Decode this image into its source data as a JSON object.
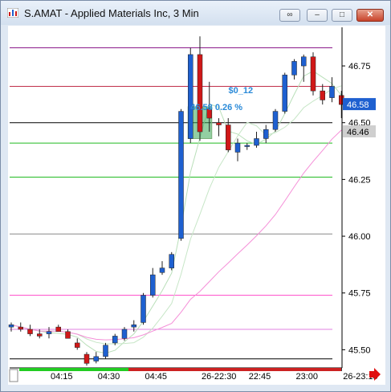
{
  "window": {
    "title": "S.AMAT - Applied Materials Inc, 3 Min",
    "buttons": [
      "link-icon",
      "minimize-icon",
      "restore-icon",
      "close-icon"
    ]
  },
  "chart_data": {
    "type": "candlestick",
    "symbol": "S.AMAT",
    "interval": "3 Min",
    "y_ticks": [
      "46.75",
      "46.50",
      "46.25",
      "46.00",
      "45.75",
      "45.50"
    ],
    "ylim": [
      45.42,
      46.92
    ],
    "x_ticks": [
      "04:15",
      "04:30",
      "04:45",
      "26-22:30",
      "22:45",
      "23:00",
      "26-23:15"
    ],
    "last_price_label": "46.58",
    "crosshair_price_label": "46.46",
    "measure": {
      "change": "$0_12",
      "detail": "46.58 0.26 %"
    },
    "levels": [
      {
        "price": 46.83,
        "color": "#8b1a8b"
      },
      {
        "price": 46.66,
        "color": "#c0304a"
      },
      {
        "price": 46.5,
        "color": "#000000"
      },
      {
        "price": 46.41,
        "color": "#22bb22"
      },
      {
        "price": 46.26,
        "color": "#22bb22"
      },
      {
        "price": 46.01,
        "color": "#888888"
      },
      {
        "price": 45.74,
        "color": "#ff55cc"
      },
      {
        "price": 45.59,
        "color": "#e080e0"
      },
      {
        "price": 45.46,
        "color": "#000000"
      }
    ],
    "candles": [
      {
        "t": "04:03",
        "o": 45.6,
        "h": 45.62,
        "l": 45.58,
        "c": 45.61
      },
      {
        "t": "04:06",
        "o": 45.6,
        "h": 45.62,
        "l": 45.58,
        "c": 45.59
      },
      {
        "t": "04:09",
        "o": 45.59,
        "h": 45.61,
        "l": 45.56,
        "c": 45.57
      },
      {
        "t": "04:12",
        "o": 45.57,
        "h": 45.59,
        "l": 45.55,
        "c": 45.56
      },
      {
        "t": "04:15",
        "o": 45.57,
        "h": 45.6,
        "l": 45.55,
        "c": 45.58
      },
      {
        "t": "04:18",
        "o": 45.6,
        "h": 45.61,
        "l": 45.58,
        "c": 45.58
      },
      {
        "t": "04:21",
        "o": 45.58,
        "h": 45.59,
        "l": 45.55,
        "c": 45.55
      },
      {
        "t": "04:24",
        "o": 45.53,
        "h": 45.55,
        "l": 45.5,
        "c": 45.51
      },
      {
        "t": "04:27",
        "o": 45.48,
        "h": 45.49,
        "l": 45.43,
        "c": 45.44
      },
      {
        "t": "04:30",
        "o": 45.45,
        "h": 45.49,
        "l": 45.44,
        "c": 45.47
      },
      {
        "t": "04:33",
        "o": 45.47,
        "h": 45.53,
        "l": 45.46,
        "c": 45.52
      },
      {
        "t": "04:36",
        "o": 45.53,
        "h": 45.57,
        "l": 45.52,
        "c": 45.56
      },
      {
        "t": "04:39",
        "o": 45.55,
        "h": 45.6,
        "l": 45.54,
        "c": 45.59
      },
      {
        "t": "04:42",
        "o": 45.6,
        "h": 45.63,
        "l": 45.58,
        "c": 45.61
      },
      {
        "t": "04:45",
        "o": 45.62,
        "h": 45.75,
        "l": 45.61,
        "c": 45.74
      },
      {
        "t": "04:48",
        "o": 45.74,
        "h": 45.86,
        "l": 45.73,
        "c": 45.83
      },
      {
        "t": "04:51",
        "o": 45.84,
        "h": 45.89,
        "l": 45.83,
        "c": 45.86
      },
      {
        "t": "04:54",
        "o": 45.86,
        "h": 45.93,
        "l": 45.85,
        "c": 45.92
      },
      {
        "t": "04:57",
        "o": 45.99,
        "h": 46.56,
        "l": 45.98,
        "c": 46.55
      },
      {
        "t": "22:27",
        "o": 46.43,
        "h": 46.83,
        "l": 46.41,
        "c": 46.8
      },
      {
        "t": "22:30",
        "o": 46.8,
        "h": 46.88,
        "l": 46.42,
        "c": 46.46
      },
      {
        "t": "22:33",
        "o": 46.56,
        "h": 46.68,
        "l": 46.46,
        "c": 46.52
      },
      {
        "t": "22:36",
        "o": 46.5,
        "h": 46.52,
        "l": 46.44,
        "c": 46.49
      },
      {
        "t": "22:39",
        "o": 46.49,
        "h": 46.52,
        "l": 46.37,
        "c": 46.38
      },
      {
        "t": "22:42",
        "o": 46.37,
        "h": 46.43,
        "l": 46.33,
        "c": 46.41
      },
      {
        "t": "22:45",
        "o": 46.4,
        "h": 46.41,
        "l": 46.38,
        "c": 46.4
      },
      {
        "t": "22:48",
        "o": 46.4,
        "h": 46.46,
        "l": 46.39,
        "c": 46.43
      },
      {
        "t": "22:51",
        "o": 46.43,
        "h": 46.49,
        "l": 46.41,
        "c": 46.47
      },
      {
        "t": "22:54",
        "o": 46.47,
        "h": 46.56,
        "l": 46.46,
        "c": 46.55
      },
      {
        "t": "22:57",
        "o": 46.55,
        "h": 46.72,
        "l": 46.54,
        "c": 46.71
      },
      {
        "t": "23:00",
        "o": 46.71,
        "h": 46.78,
        "l": 46.69,
        "c": 46.77
      },
      {
        "t": "23:03",
        "o": 46.75,
        "h": 46.8,
        "l": 46.68,
        "c": 46.79
      },
      {
        "t": "23:06",
        "o": 46.79,
        "h": 46.81,
        "l": 46.62,
        "c": 46.64
      },
      {
        "t": "23:09",
        "o": 46.64,
        "h": 46.67,
        "l": 46.58,
        "c": 46.6
      },
      {
        "t": "23:12",
        "o": 46.61,
        "h": 46.7,
        "l": 46.59,
        "c": 46.66
      },
      {
        "t": "23:15",
        "o": 46.62,
        "h": 46.64,
        "l": 46.52,
        "c": 46.58
      }
    ],
    "colors": {
      "up": "#1e60d0",
      "down": "#d01818",
      "bg": "#ffffff",
      "axis": "#000000",
      "price_tag": "#1e60d0"
    }
  },
  "status": {
    "arrow": "red-right-arrow-icon"
  }
}
